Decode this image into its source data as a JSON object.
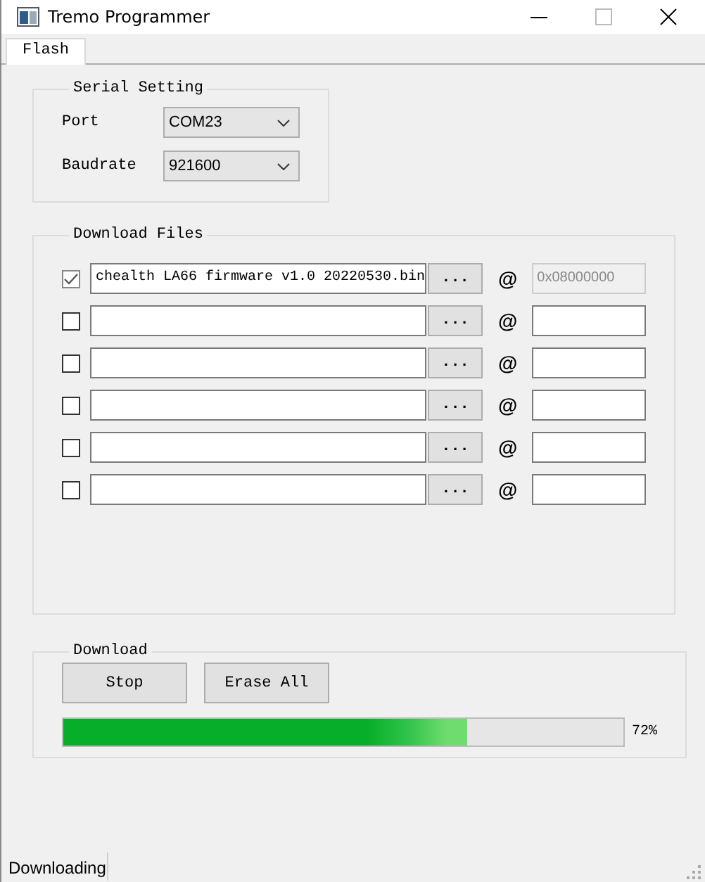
{
  "window": {
    "title": "Tremo Programmer"
  },
  "tabs": [
    {
      "label": "Flash",
      "selected": true
    }
  ],
  "serial_setting": {
    "title": "Serial Setting",
    "fields": [
      {
        "label": "Port",
        "value": "COM23"
      },
      {
        "label": "Baudrate",
        "value": "921600"
      }
    ]
  },
  "download_files": {
    "title": "Download Files",
    "rows": [
      {
        "checked": true,
        "file": "chealth LA66 firmware v1.0 20220530.bin",
        "browse": "...",
        "at": "@",
        "address": "0x08000000",
        "address_disabled": true
      },
      {
        "checked": false,
        "browse": "...",
        "at": "@",
        "address_disabled": false
      },
      {
        "checked": false,
        "browse": "...",
        "at": "@",
        "address_disabled": false
      },
      {
        "checked": false,
        "browse": "...",
        "at": "@",
        "address_disabled": false
      },
      {
        "checked": false,
        "browse": "...",
        "at": "@",
        "address_disabled": false
      },
      {
        "checked": false,
        "browse": "...",
        "at": "@",
        "address_disabled": false
      }
    ]
  },
  "download": {
    "title": "Download",
    "buttons": [
      "Stop",
      "Erase All"
    ],
    "progress": {
      "level": 0.72,
      "reading": "72%"
    }
  },
  "status_bar": {
    "text": "Downloading"
  }
}
